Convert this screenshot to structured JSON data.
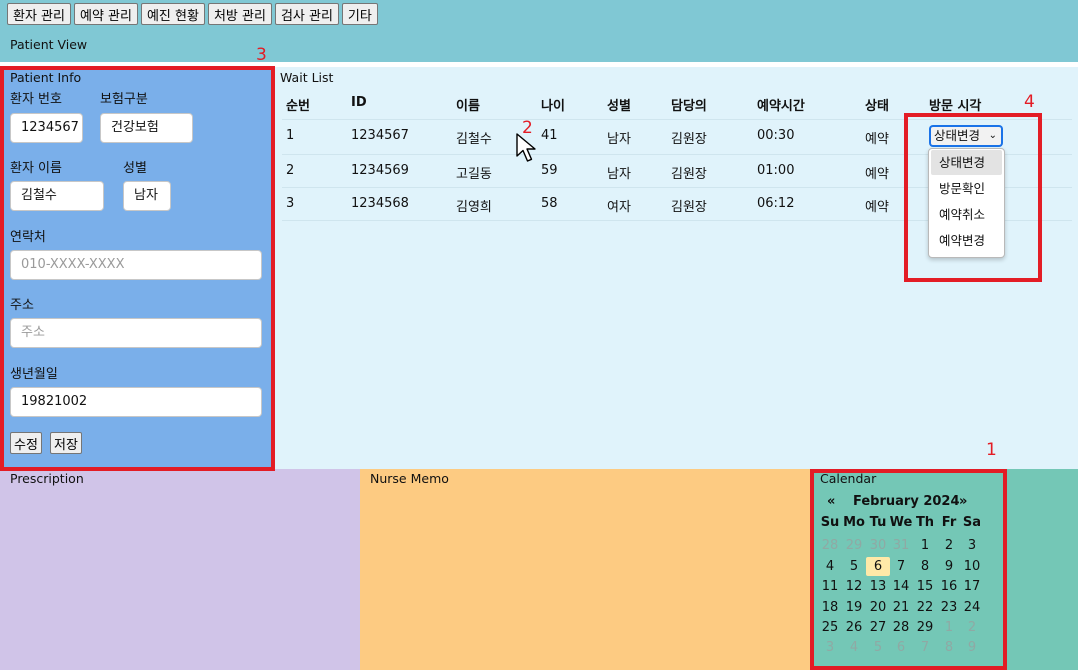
{
  "menu": [
    "환자 관리",
    "예약 관리",
    "예진 현황",
    "처방 관리",
    "검사 관리",
    "기타"
  ],
  "view_title": "Patient View",
  "patient_info": {
    "title": "Patient Info",
    "patient_no_label": "환자 번호",
    "patient_no": "1234567",
    "insurance_label": "보험구분",
    "insurance": "건강보험",
    "name_label": "환자 이름",
    "name": "김철수",
    "gender_label": "성별",
    "gender": "남자",
    "contact_label": "연락처",
    "contact_placeholder": "010-XXXX-XXXX",
    "address_label": "주소",
    "address_placeholder": "주소",
    "birth_label": "생년월일",
    "birth": "19821002",
    "edit_button": "수정",
    "save_button": "저장"
  },
  "wait_list": {
    "title": "Wait List",
    "headers": [
      "순번",
      "ID",
      "이름",
      "나이",
      "성별",
      "담당의",
      "예약시간",
      "상태",
      "방문 시각"
    ],
    "rows": [
      {
        "no": "1",
        "id": "1234567",
        "name": "김철수",
        "age": "41",
        "gender": "남자",
        "doctor": "김원장",
        "time": "00:30",
        "status": "예약"
      },
      {
        "no": "2",
        "id": "1234569",
        "name": "고길동",
        "age": "59",
        "gender": "남자",
        "doctor": "김원장",
        "time": "01:00",
        "status": "예약"
      },
      {
        "no": "3",
        "id": "1234568",
        "name": "김영희",
        "age": "58",
        "gender": "여자",
        "doctor": "김원장",
        "time": "06:12",
        "status": "예약"
      }
    ],
    "status_select": {
      "selected": "상태변경",
      "options": [
        "상태변경",
        "방문확인",
        "예약취소",
        "예약변경"
      ]
    }
  },
  "prescription": {
    "title": "Prescription"
  },
  "nurse_memo": {
    "title": "Nurse Memo"
  },
  "calendar": {
    "title": "Calendar",
    "prev": "«",
    "next": "»",
    "month_label": "February 2024",
    "dow": [
      "Su",
      "Mo",
      "Tu",
      "We",
      "Th",
      "Fr",
      "Sa"
    ],
    "weeks": [
      [
        "28",
        "29",
        "30",
        "31",
        "1",
        "2",
        "3"
      ],
      [
        "4",
        "5",
        "6",
        "7",
        "8",
        "9",
        "10"
      ],
      [
        "11",
        "12",
        "13",
        "14",
        "15",
        "16",
        "17"
      ],
      [
        "18",
        "19",
        "20",
        "21",
        "22",
        "23",
        "24"
      ],
      [
        "25",
        "26",
        "27",
        "28",
        "29",
        "1",
        "2"
      ],
      [
        "3",
        "4",
        "5",
        "6",
        "7",
        "8",
        "9"
      ]
    ],
    "today": "6"
  },
  "annotations": [
    "1",
    "2",
    "3",
    "4"
  ],
  "colors": {
    "topbar": "#80c8d4",
    "patient_panel": "#7aafea",
    "wait_panel": "#e0f3fb",
    "prescription": "#d0c4e8",
    "nurse_memo": "#fdcb82",
    "calendar": "#74c7b6",
    "annotation_red": "#e31c25"
  }
}
